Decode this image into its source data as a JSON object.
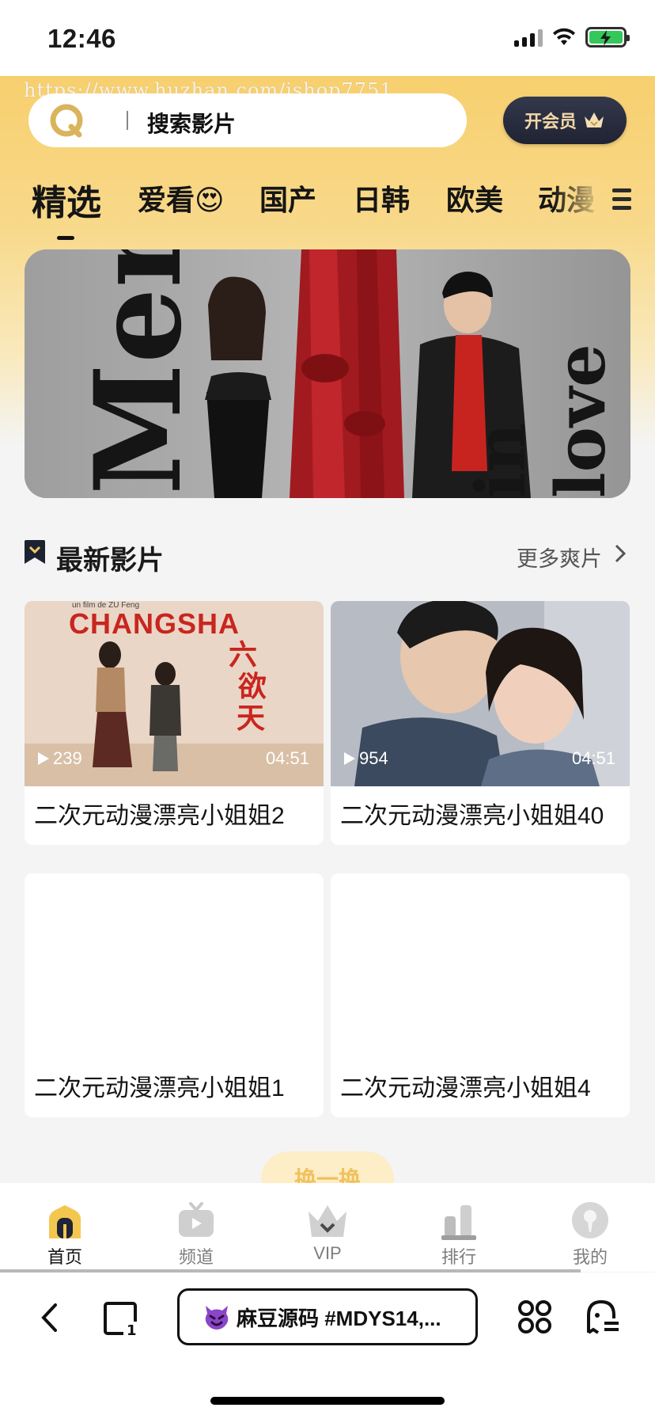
{
  "status_bar": {
    "time": "12:46"
  },
  "watermark": "https://www.huzhan.com/ishop7751",
  "header": {
    "search_placeholder": "搜索影片",
    "vip_button": "开会员"
  },
  "tabs": [
    {
      "label": "精选",
      "active": true
    },
    {
      "label": "爱看😍",
      "active": false
    },
    {
      "label": "国产",
      "active": false
    },
    {
      "label": "日韩",
      "active": false
    },
    {
      "label": "欧美",
      "active": false
    },
    {
      "label": "动漫",
      "active": false
    }
  ],
  "banner": {
    "left_text": "Men",
    "right_text": "in love"
  },
  "section": {
    "title": "最新影片",
    "more": "更多爽片"
  },
  "videos": [
    {
      "title": "二次元动漫漂亮小姐姐2",
      "views": "239",
      "duration": "04:51",
      "poster_text": "CHANGSHA",
      "poster_sub": "un film de ZU Feng",
      "poster_cn": "六欲天"
    },
    {
      "title": "二次元动漫漂亮小姐姐40",
      "views": "954",
      "duration": "04:51"
    },
    {
      "title": "二次元动漫漂亮小姐姐1"
    },
    {
      "title": "二次元动漫漂亮小姐姐4"
    }
  ],
  "refresh_button": "换一换",
  "bottom_nav": [
    {
      "label": "首页",
      "icon": "home-icon",
      "active": true
    },
    {
      "label": "频道",
      "icon": "tv-icon",
      "active": false
    },
    {
      "label": "VIP",
      "icon": "crown-icon",
      "active": false
    },
    {
      "label": "排行",
      "icon": "ranking-icon",
      "active": false
    },
    {
      "label": "我的",
      "icon": "profile-icon",
      "active": false
    }
  ],
  "browser": {
    "url_title": "麻豆源码 #MDYS14,..."
  },
  "colors": {
    "accent": "#f7cf6e",
    "vip_dark": "#232738",
    "active_text": "#111111"
  }
}
